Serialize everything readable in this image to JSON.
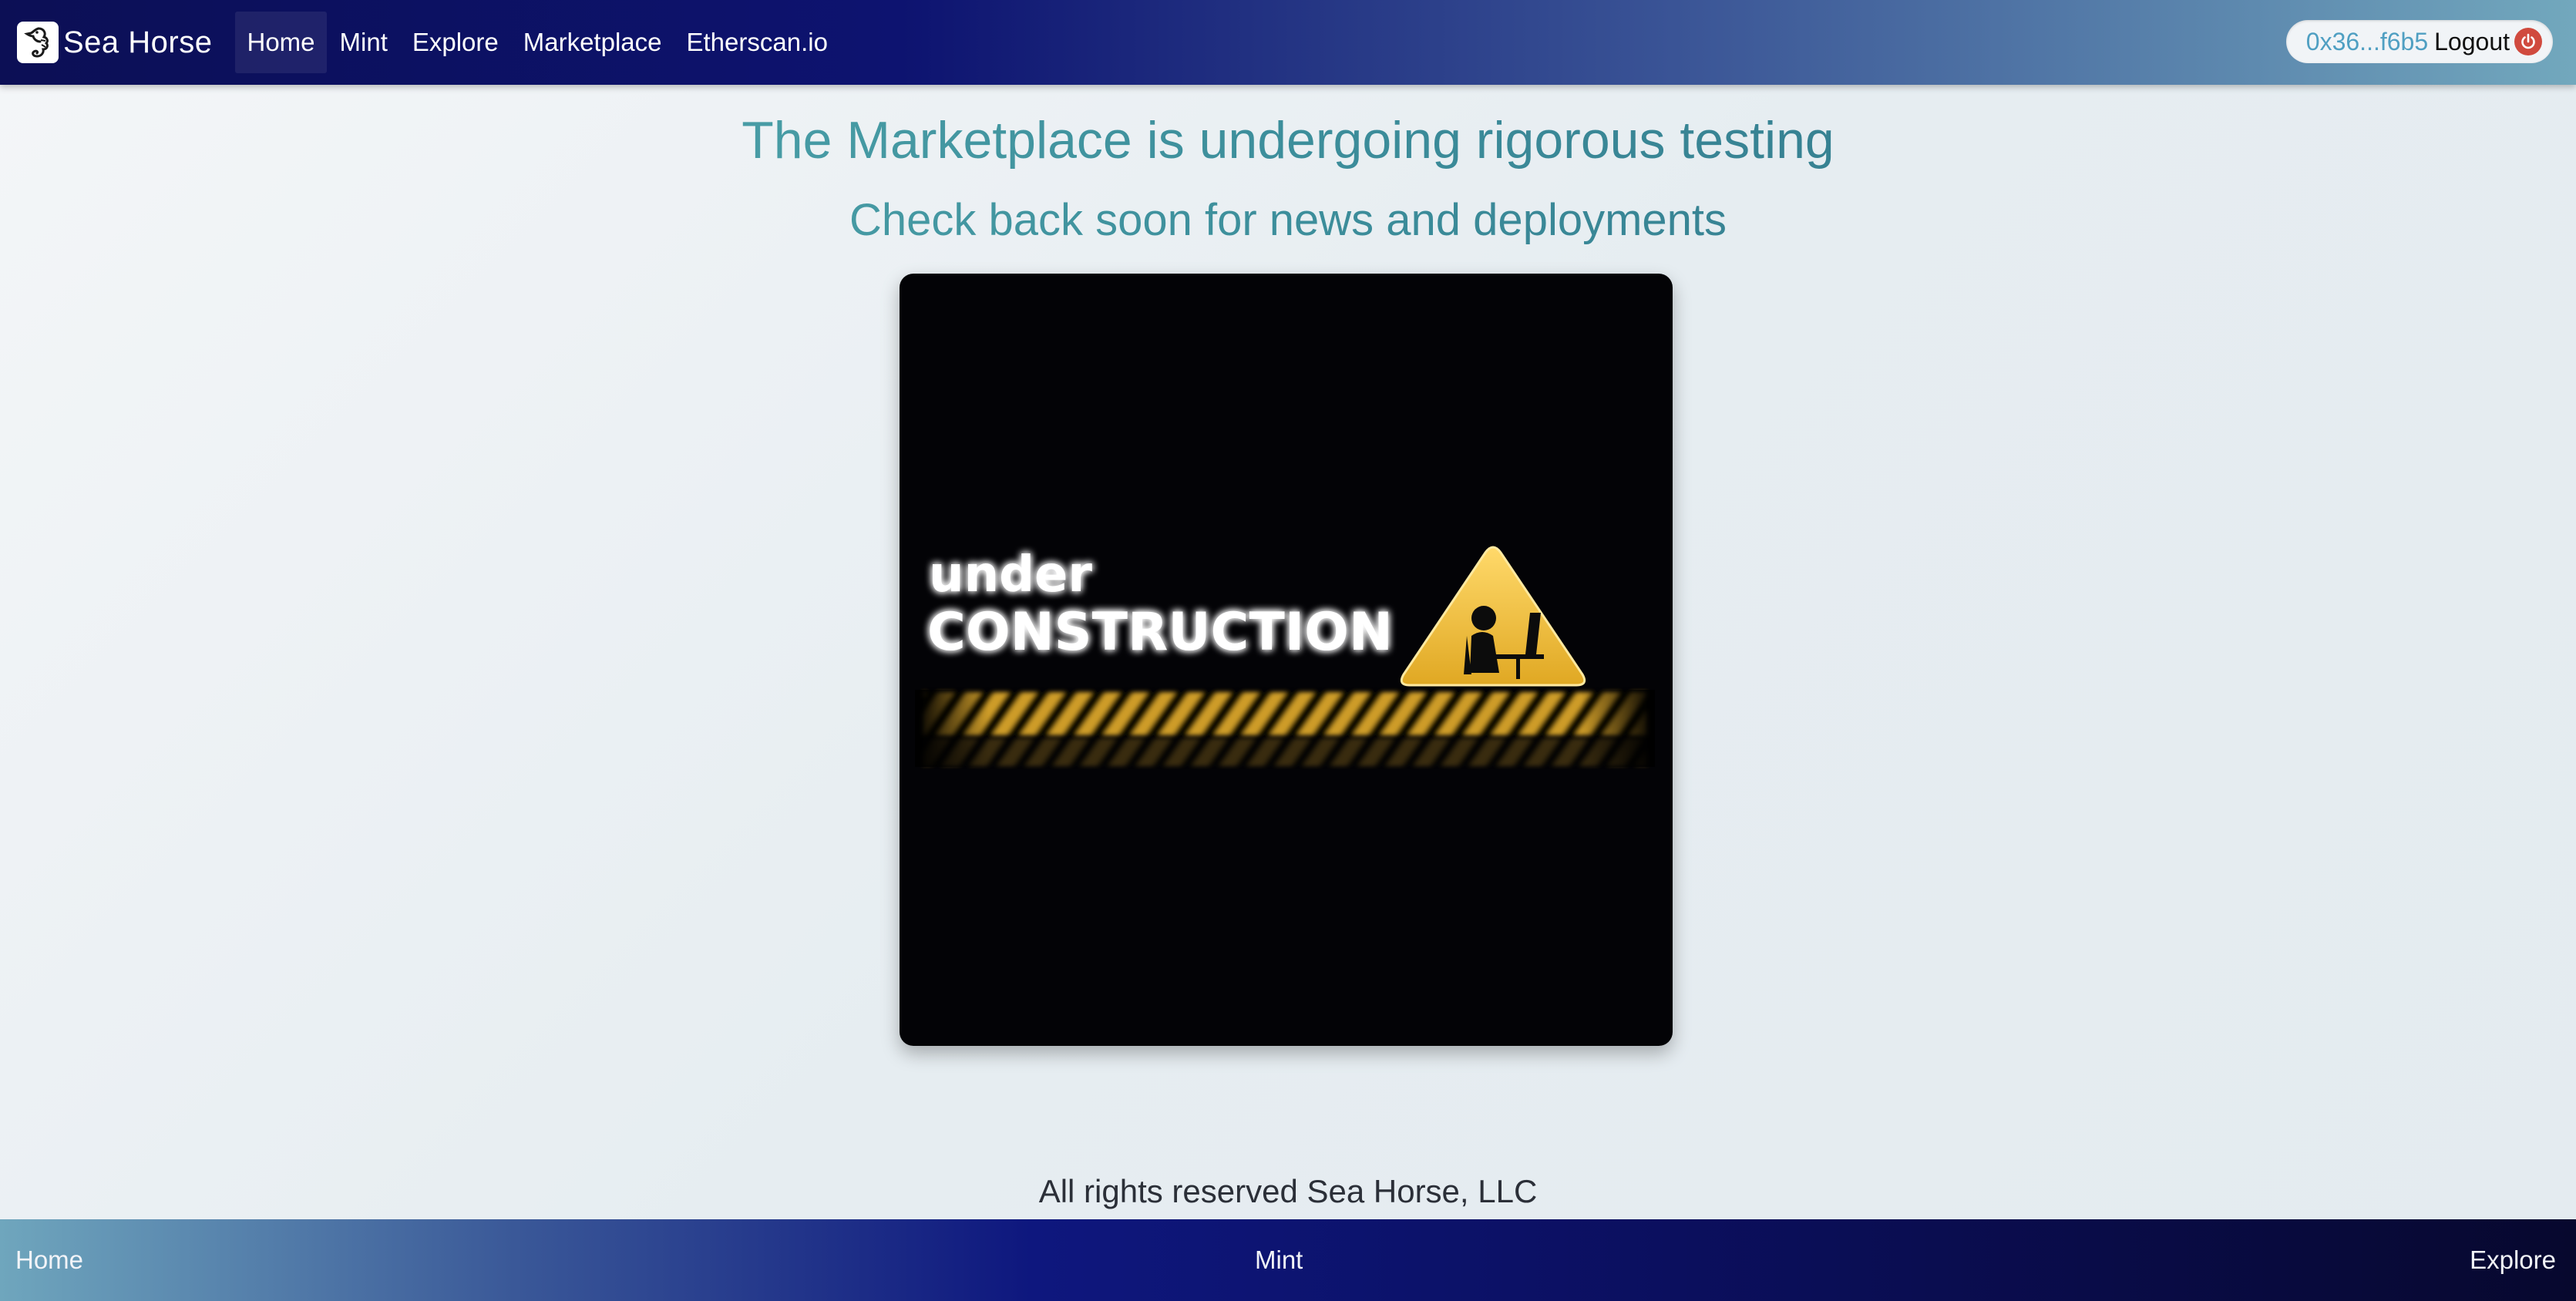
{
  "brand": {
    "name": "Sea Horse"
  },
  "nav": {
    "items": [
      {
        "label": "Home"
      },
      {
        "label": "Mint"
      },
      {
        "label": "Explore"
      },
      {
        "label": "Marketplace"
      },
      {
        "label": "Etherscan.io"
      }
    ],
    "active": "Home"
  },
  "wallet": {
    "address": "0x36...f6b5",
    "logout_label": "Logout"
  },
  "main": {
    "headline": "The Marketplace is undergoing rigorous testing",
    "subheadline": "Check back soon for news and deployments",
    "banner": {
      "line1": "under",
      "line2": "CONSTRUCTION"
    }
  },
  "footer": {
    "copyright": "All rights reserved Sea Horse, LLC",
    "links": {
      "home": "Home",
      "mint": "Mint",
      "explore": "Explore"
    }
  },
  "icons": {
    "brand": "seahorse-logo-icon",
    "logout": "power-icon",
    "banner": "warning-triangle-icon"
  },
  "colors": {
    "accent_teal": "#3c8e9b",
    "wallet_address": "#4f9fc2",
    "logout_red": "#d04a3e",
    "warning_yellow": "#f0c23a"
  }
}
